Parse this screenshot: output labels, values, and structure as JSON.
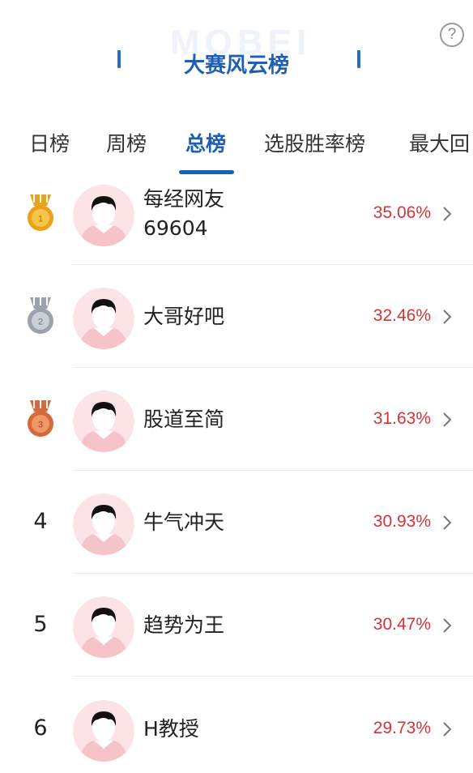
{
  "header": {
    "watermark": "MOBEI",
    "title": "大赛风云榜",
    "help_glyph": "?"
  },
  "tabs": [
    {
      "label": "日榜",
      "active": false
    },
    {
      "label": "周榜",
      "active": false
    },
    {
      "label": "总榜",
      "active": true
    },
    {
      "label": "选股胜率榜",
      "active": false
    },
    {
      "label": "最大回",
      "active": false
    }
  ],
  "colors": {
    "accent": "#1f5fb3",
    "gain": "#d2343a",
    "gold": "#e8a21c",
    "silver": "#9aa3ad",
    "bronze": "#d46a3c"
  },
  "leaderboard": [
    {
      "rank": "1",
      "medal": "gold",
      "name_line1": "每经网友",
      "name_line2": "69604",
      "return": "35.06%"
    },
    {
      "rank": "2",
      "medal": "silver",
      "name_line1": "大哥好吧",
      "name_line2": "",
      "return": "32.46%"
    },
    {
      "rank": "3",
      "medal": "bronze",
      "name_line1": "股道至简",
      "name_line2": "",
      "return": "31.63%"
    },
    {
      "rank": "4",
      "medal": "",
      "name_line1": "牛气冲天",
      "name_line2": "",
      "return": "30.93%"
    },
    {
      "rank": "5",
      "medal": "",
      "name_line1": "趋势为王",
      "name_line2": "",
      "return": "30.47%"
    },
    {
      "rank": "6",
      "medal": "",
      "name_line1": "H教授",
      "name_line2": "",
      "return": "29.73%"
    }
  ],
  "icons": {
    "medal": "medal-icon",
    "avatar": "avatar-icon",
    "chevron": "chevron-right-icon",
    "help": "help-icon"
  }
}
